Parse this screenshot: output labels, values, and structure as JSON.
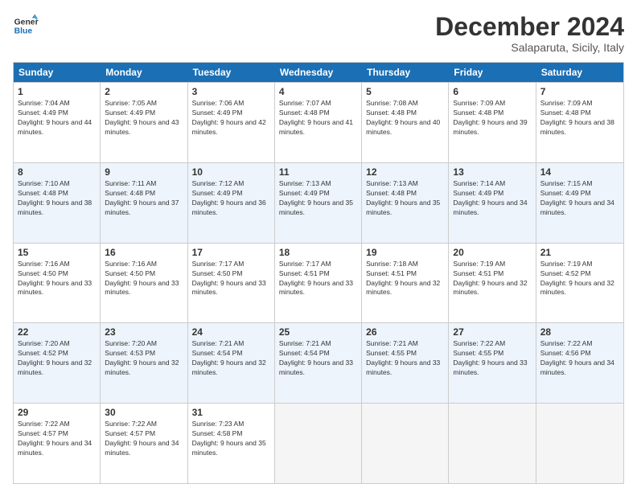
{
  "header": {
    "logo_line1": "General",
    "logo_line2": "Blue",
    "month": "December 2024",
    "location": "Salaparuta, Sicily, Italy"
  },
  "weekdays": [
    "Sunday",
    "Monday",
    "Tuesday",
    "Wednesday",
    "Thursday",
    "Friday",
    "Saturday"
  ],
  "rows": [
    [
      {
        "day": "1",
        "sunrise": "Sunrise: 7:04 AM",
        "sunset": "Sunset: 4:49 PM",
        "daylight": "Daylight: 9 hours and 44 minutes."
      },
      {
        "day": "2",
        "sunrise": "Sunrise: 7:05 AM",
        "sunset": "Sunset: 4:49 PM",
        "daylight": "Daylight: 9 hours and 43 minutes."
      },
      {
        "day": "3",
        "sunrise": "Sunrise: 7:06 AM",
        "sunset": "Sunset: 4:49 PM",
        "daylight": "Daylight: 9 hours and 42 minutes."
      },
      {
        "day": "4",
        "sunrise": "Sunrise: 7:07 AM",
        "sunset": "Sunset: 4:48 PM",
        "daylight": "Daylight: 9 hours and 41 minutes."
      },
      {
        "day": "5",
        "sunrise": "Sunrise: 7:08 AM",
        "sunset": "Sunset: 4:48 PM",
        "daylight": "Daylight: 9 hours and 40 minutes."
      },
      {
        "day": "6",
        "sunrise": "Sunrise: 7:09 AM",
        "sunset": "Sunset: 4:48 PM",
        "daylight": "Daylight: 9 hours and 39 minutes."
      },
      {
        "day": "7",
        "sunrise": "Sunrise: 7:09 AM",
        "sunset": "Sunset: 4:48 PM",
        "daylight": "Daylight: 9 hours and 38 minutes."
      }
    ],
    [
      {
        "day": "8",
        "sunrise": "Sunrise: 7:10 AM",
        "sunset": "Sunset: 4:48 PM",
        "daylight": "Daylight: 9 hours and 38 minutes."
      },
      {
        "day": "9",
        "sunrise": "Sunrise: 7:11 AM",
        "sunset": "Sunset: 4:48 PM",
        "daylight": "Daylight: 9 hours and 37 minutes."
      },
      {
        "day": "10",
        "sunrise": "Sunrise: 7:12 AM",
        "sunset": "Sunset: 4:49 PM",
        "daylight": "Daylight: 9 hours and 36 minutes."
      },
      {
        "day": "11",
        "sunrise": "Sunrise: 7:13 AM",
        "sunset": "Sunset: 4:49 PM",
        "daylight": "Daylight: 9 hours and 35 minutes."
      },
      {
        "day": "12",
        "sunrise": "Sunrise: 7:13 AM",
        "sunset": "Sunset: 4:48 PM",
        "daylight": "Daylight: 9 hours and 35 minutes."
      },
      {
        "day": "13",
        "sunrise": "Sunrise: 7:14 AM",
        "sunset": "Sunset: 4:49 PM",
        "daylight": "Daylight: 9 hours and 34 minutes."
      },
      {
        "day": "14",
        "sunrise": "Sunrise: 7:15 AM",
        "sunset": "Sunset: 4:49 PM",
        "daylight": "Daylight: 9 hours and 34 minutes."
      }
    ],
    [
      {
        "day": "15",
        "sunrise": "Sunrise: 7:16 AM",
        "sunset": "Sunset: 4:50 PM",
        "daylight": "Daylight: 9 hours and 33 minutes."
      },
      {
        "day": "16",
        "sunrise": "Sunrise: 7:16 AM",
        "sunset": "Sunset: 4:50 PM",
        "daylight": "Daylight: 9 hours and 33 minutes."
      },
      {
        "day": "17",
        "sunrise": "Sunrise: 7:17 AM",
        "sunset": "Sunset: 4:50 PM",
        "daylight": "Daylight: 9 hours and 33 minutes."
      },
      {
        "day": "18",
        "sunrise": "Sunrise: 7:17 AM",
        "sunset": "Sunset: 4:51 PM",
        "daylight": "Daylight: 9 hours and 33 minutes."
      },
      {
        "day": "19",
        "sunrise": "Sunrise: 7:18 AM",
        "sunset": "Sunset: 4:51 PM",
        "daylight": "Daylight: 9 hours and 32 minutes."
      },
      {
        "day": "20",
        "sunrise": "Sunrise: 7:19 AM",
        "sunset": "Sunset: 4:51 PM",
        "daylight": "Daylight: 9 hours and 32 minutes."
      },
      {
        "day": "21",
        "sunrise": "Sunrise: 7:19 AM",
        "sunset": "Sunset: 4:52 PM",
        "daylight": "Daylight: 9 hours and 32 minutes."
      }
    ],
    [
      {
        "day": "22",
        "sunrise": "Sunrise: 7:20 AM",
        "sunset": "Sunset: 4:52 PM",
        "daylight": "Daylight: 9 hours and 32 minutes."
      },
      {
        "day": "23",
        "sunrise": "Sunrise: 7:20 AM",
        "sunset": "Sunset: 4:53 PM",
        "daylight": "Daylight: 9 hours and 32 minutes."
      },
      {
        "day": "24",
        "sunrise": "Sunrise: 7:21 AM",
        "sunset": "Sunset: 4:54 PM",
        "daylight": "Daylight: 9 hours and 32 minutes."
      },
      {
        "day": "25",
        "sunrise": "Sunrise: 7:21 AM",
        "sunset": "Sunset: 4:54 PM",
        "daylight": "Daylight: 9 hours and 33 minutes."
      },
      {
        "day": "26",
        "sunrise": "Sunrise: 7:21 AM",
        "sunset": "Sunset: 4:55 PM",
        "daylight": "Daylight: 9 hours and 33 minutes."
      },
      {
        "day": "27",
        "sunrise": "Sunrise: 7:22 AM",
        "sunset": "Sunset: 4:55 PM",
        "daylight": "Daylight: 9 hours and 33 minutes."
      },
      {
        "day": "28",
        "sunrise": "Sunrise: 7:22 AM",
        "sunset": "Sunset: 4:56 PM",
        "daylight": "Daylight: 9 hours and 34 minutes."
      }
    ],
    [
      {
        "day": "29",
        "sunrise": "Sunrise: 7:22 AM",
        "sunset": "Sunset: 4:57 PM",
        "daylight": "Daylight: 9 hours and 34 minutes."
      },
      {
        "day": "30",
        "sunrise": "Sunrise: 7:22 AM",
        "sunset": "Sunset: 4:57 PM",
        "daylight": "Daylight: 9 hours and 34 minutes."
      },
      {
        "day": "31",
        "sunrise": "Sunrise: 7:23 AM",
        "sunset": "Sunset: 4:58 PM",
        "daylight": "Daylight: 9 hours and 35 minutes."
      },
      null,
      null,
      null,
      null
    ]
  ]
}
